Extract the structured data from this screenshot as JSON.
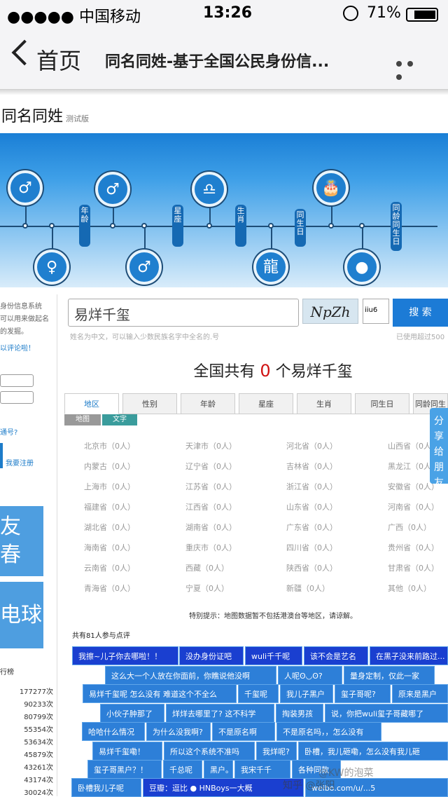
{
  "status_bar": {
    "carrier": "●●●●● 中国移动",
    "time": "13:26",
    "battery": "71%"
  },
  "nav": {
    "back_label": "首页",
    "title": "同名同姓-基于全国公民身份信..."
  },
  "site": {
    "title": "同名同姓",
    "badge": "测试版"
  },
  "banner": {
    "tags": [
      "年龄",
      "星座",
      "生肖",
      "同生日",
      "同龄同生日"
    ],
    "icon_names": [
      "male-icon",
      "male-icon",
      "libra-icon",
      "cake-icon",
      "female-icon",
      "male-icon",
      "dragon-icon",
      "user-icon"
    ]
  },
  "left_panel": {
    "intro": [
      "身份信息系统",
      "可以用来做起名",
      "的发掘。"
    ],
    "comment_link": "以评论啦！",
    "field_hint": "通号?",
    "register": "我要注册",
    "card1": [
      "友",
      "春"
    ],
    "card2": "电球",
    "rank_title": "行榜",
    "rank_values": [
      "177277次",
      "90233次",
      "80799次",
      "55354次",
      "53634次",
      "45879次",
      "43261次",
      "43174次",
      "30024次"
    ]
  },
  "search": {
    "value": "易烊千玺",
    "captcha": "NpZh",
    "captcha_value": "iiu6",
    "button": "搜 索",
    "hint": "姓名为中文，可以输入少数民族名字中全名的.号",
    "hint_right": "已使用超过500"
  },
  "result": {
    "prefix": "全国共有",
    "count": "0",
    "mid": "个",
    "name": "易烊千玺"
  },
  "tabs": [
    "地区",
    "性别",
    "年龄",
    "星座",
    "生肖",
    "同生日",
    "同龄同生"
  ],
  "subtabs": [
    "地图",
    "文字"
  ],
  "regions": [
    "北京市（0人）",
    "天津市（0人）",
    "河北省（0人）",
    "山西省（0人）",
    "内蒙古（0人）",
    "辽宁省（0人）",
    "吉林省（0人）",
    "黑龙江（0人）",
    "上海市（0人）",
    "江苏省（0人）",
    "浙江省（0人）",
    "安徽省（0人）",
    "福建省（0人）",
    "江西省（0人）",
    "山东省（0人）",
    "河南省（0人）",
    "湖北省（0人）",
    "湖南省（0人）",
    "广东省（0人）",
    "广西（0人）",
    "海南省（0人）",
    "重庆市（0人）",
    "四川省（0人）",
    "贵州省（0人）",
    "云南省（0人）",
    "西藏（0人）",
    "陕西省（0人）",
    "甘肃省（0人）",
    "青海省（0人）",
    "宁夏（0人）",
    "新疆（0人）",
    "其他（0人）"
  ],
  "map_note": "特别提示：地图数据暂不包括港澳台等地区，请谅解。",
  "comment_header": "共有81人参与点评",
  "comments": [
    "我擦~儿子你去哪啦！！",
    "没办身份证吧",
    "wuli千千呢",
    "该不会是艺名",
    "在黑子没来前路过...",
    "这么大一个人放在你面前，你瞧说他没啊",
    "人呢ʘ◡ʘ?",
    "量身定制，仅此一家",
    "易烊千玺呢 怎么没有 难道这个不全么",
    "千玺呢",
    "我儿子黑户",
    "玺子哥呢?",
    "原来是黑户",
    "小伙子肿那了",
    "烊烊去哪里了? 这不科学",
    "掏装男孩",
    "说，你把wuli玺子哥藏哪了",
    "哈哈什么情况",
    "为什么没我啊?",
    "不是原名啊",
    "不是原名吗，，怎么没有",
    "易烊千玺嘞！",
    "所以这个系统不准吗",
    "我烊呢?",
    "卧槽，我儿砸嘞，怎么没有我儿砸",
    "玺子哥黑户？！",
    "千总呢",
    "黑户。",
    "我宋千千",
    "各种同款",
    "卧槽我儿子呢",
    "豆瓣：逗比 ● HNBoys一大概",
    "weibo.com/u/...5"
  ],
  "share": "分享给朋友",
  "watermark": {
    "line1": "@KW的泡菜",
    "line2": "知乎 @张阳"
  }
}
